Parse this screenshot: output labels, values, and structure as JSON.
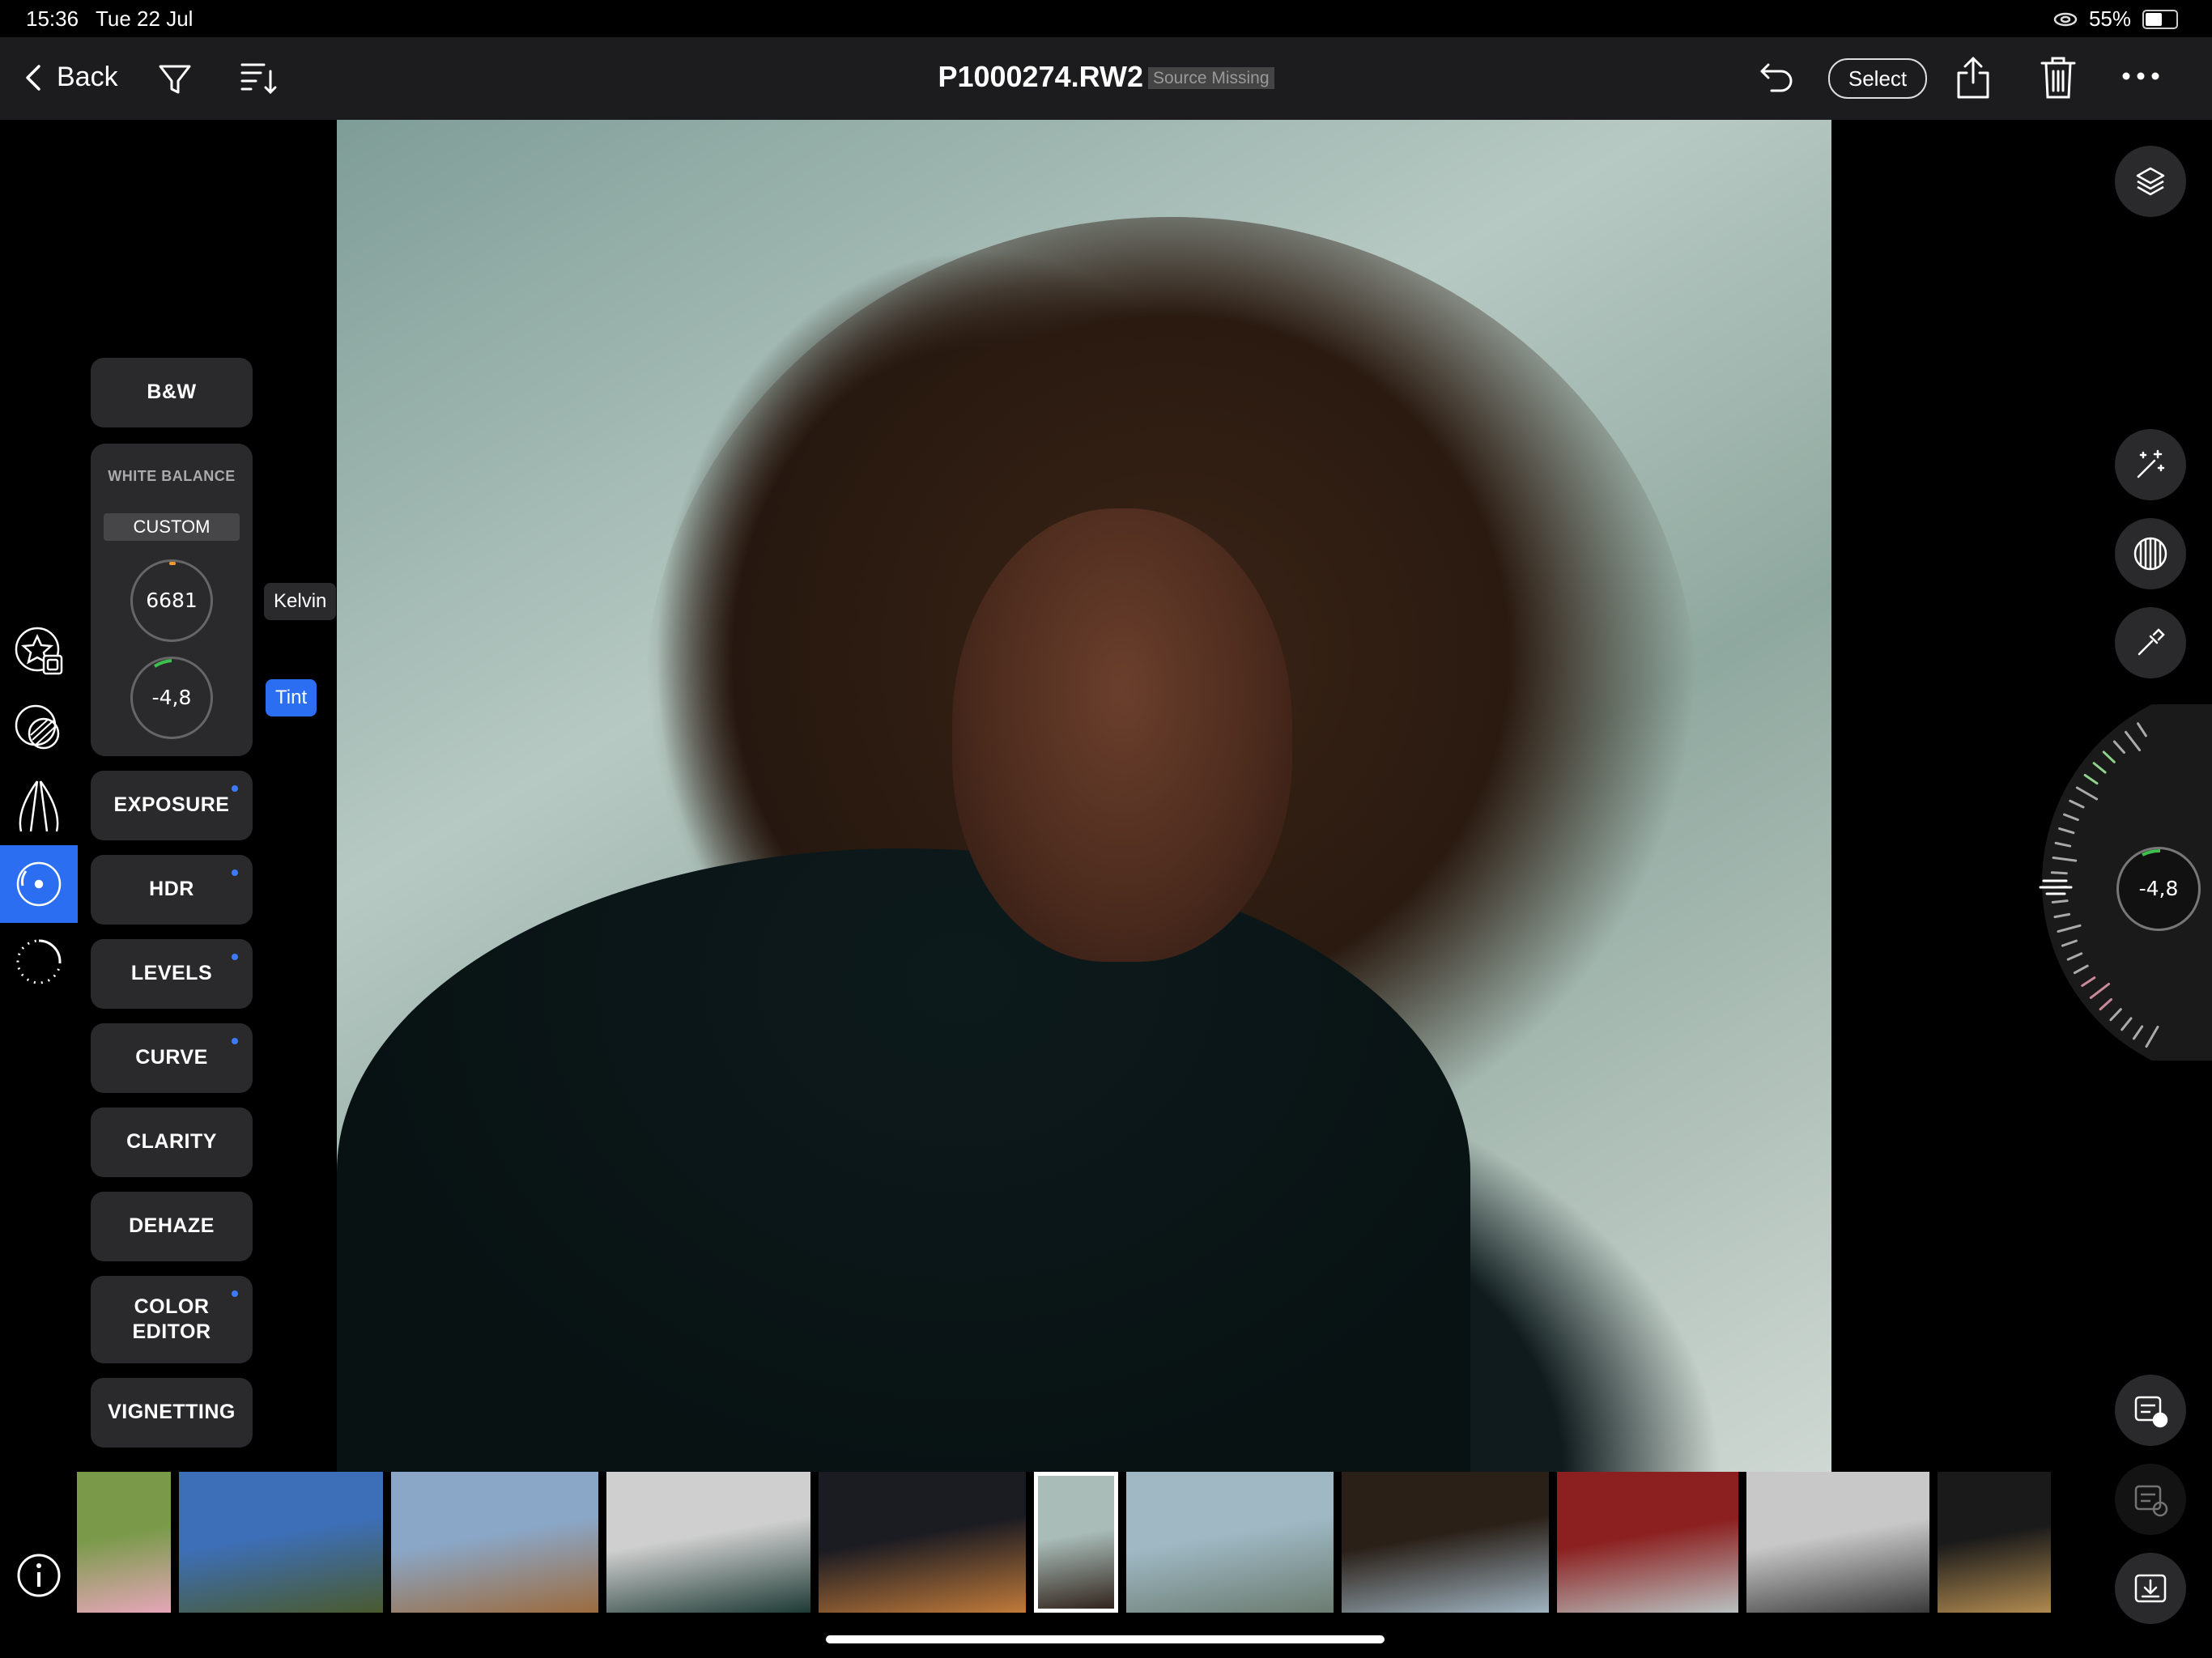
{
  "status": {
    "time": "15:36",
    "date": "Tue 22 Jul",
    "battery": "55%",
    "battery_level": 0.55
  },
  "nav": {
    "back_label": "Back",
    "title": "P1000274.RW2",
    "badge": "Source Missing",
    "select_label": "Select"
  },
  "icons": {
    "back": "chevron-left-icon",
    "filter": "filter-icon",
    "sort": "sort-icon",
    "undo": "undo-icon",
    "share": "share-icon",
    "delete": "trash-icon",
    "more": "ellipsis-icon",
    "layers": "layers-icon",
    "auto": "magic-wand-icon",
    "lut": "film-grain-icon",
    "picker": "eyedropper-icon",
    "info": "info-icon"
  },
  "panel": {
    "bw": "B&W",
    "white_balance": {
      "title": "WHITE BALANCE",
      "preset": "CUSTOM",
      "kelvin_value": "6681",
      "kelvin_label": "Kelvin",
      "tint_value": "-4,8",
      "tint_label": "Tint"
    },
    "buttons": [
      {
        "label": "EXPOSURE",
        "modified": true
      },
      {
        "label": "HDR",
        "modified": true
      },
      {
        "label": "LEVELS",
        "modified": true
      },
      {
        "label": "CURVE",
        "modified": true
      },
      {
        "label": "CLARITY",
        "modified": false
      },
      {
        "label": "DEHAZE",
        "modified": false
      },
      {
        "label": "COLOR\nEDITOR",
        "modified": true
      },
      {
        "label": "VIGNETTING",
        "modified": false
      }
    ]
  },
  "wheel": {
    "value": "-4,8"
  },
  "colors": {
    "accent": "#2c6ef2",
    "panel": "#2a2a2c",
    "navbar": "#1c1c1e"
  },
  "filmstrip": [
    {
      "name": "roses-photo",
      "c1": "#7a9a4a",
      "c2": "#e5a6b8",
      "selected": false
    },
    {
      "name": "city-park-photo",
      "c1": "#3d6fb8",
      "c2": "#4a5a2e",
      "selected": false
    },
    {
      "name": "fountain-photo",
      "c1": "#8aa7c8",
      "c2": "#9c6b3e",
      "selected": false
    },
    {
      "name": "mini-car-photo",
      "c1": "#cfcfcf",
      "c2": "#1e3a34",
      "selected": false
    },
    {
      "name": "night-street-photo",
      "c1": "#1b1b22",
      "c2": "#c07a3a",
      "selected": false
    },
    {
      "name": "portrait-photo",
      "c1": "#a9bcb8",
      "c2": "#2b1c14",
      "selected": true
    },
    {
      "name": "beach-woman-photo",
      "c1": "#9fb8c4",
      "c2": "#6b7c70",
      "selected": false
    },
    {
      "name": "window-beach-photo",
      "c1": "#2a2018",
      "c2": "#9fb3c0",
      "selected": false
    },
    {
      "name": "red-leaves-photo",
      "c1": "#8c2020",
      "c2": "#b9c0c0",
      "selected": false
    },
    {
      "name": "airplane-photo",
      "c1": "#c8c8c8",
      "c2": "#3a3a3a",
      "selected": false
    },
    {
      "name": "cockpit-photo",
      "c1": "#1a1a1a",
      "c2": "#b08a50",
      "selected": false
    }
  ]
}
